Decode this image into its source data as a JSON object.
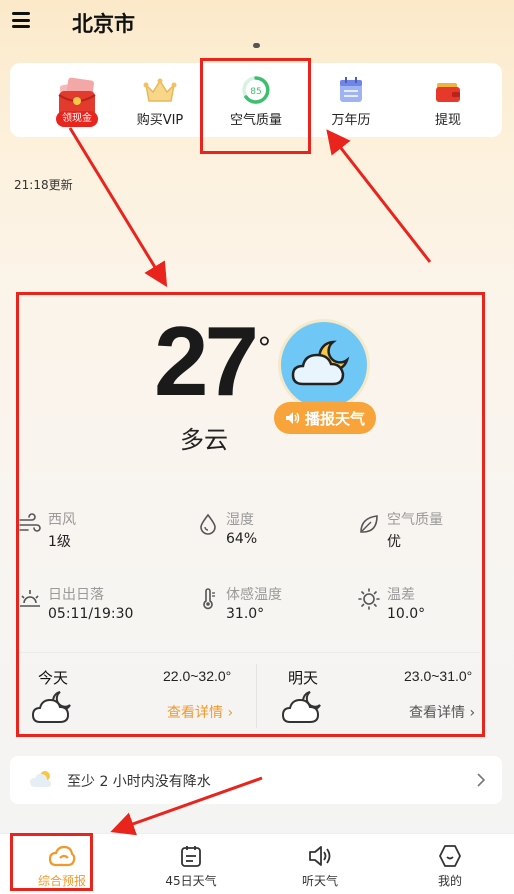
{
  "header": {
    "city": "北京市"
  },
  "shortcuts": [
    {
      "label": "",
      "badge": "领现金",
      "icon": "red-envelope-icon"
    },
    {
      "label": "购买VIP",
      "icon": "vip-crown-icon"
    },
    {
      "label": "空气质量",
      "icon": "air-quality-gauge-icon",
      "gauge_value": "85"
    },
    {
      "label": "万年历",
      "icon": "calendar-icon"
    },
    {
      "label": "提现",
      "icon": "wallet-icon"
    }
  ],
  "update_time": "21:18更新",
  "current": {
    "temperature": "27",
    "degree_symbol": "°",
    "condition": "多云",
    "broadcast_label": "播报天气",
    "icon": "partly-cloudy-night-icon"
  },
  "stats": [
    {
      "label": "西风",
      "value": "1级",
      "icon": "wind-icon"
    },
    {
      "label": "湿度",
      "value": "64%",
      "icon": "humidity-drop-icon"
    },
    {
      "label": "空气质量",
      "value": "优",
      "icon": "leaf-icon"
    },
    {
      "label": "日出日落",
      "value": "05:11/19:30",
      "icon": "sunrise-icon"
    },
    {
      "label": "体感温度",
      "value": "31.0°",
      "icon": "thermometer-icon"
    },
    {
      "label": "温差",
      "value": "10.0°",
      "icon": "sun-icon"
    }
  ],
  "forecast": {
    "today": {
      "title": "今天",
      "range": "22.0~32.0°",
      "link": "查看详情 ›",
      "link_color": "#f19a2c"
    },
    "tomorrow": {
      "title": "明天",
      "range": "23.0~31.0°",
      "link": "查看详情 ›",
      "link_color": "#555555"
    }
  },
  "rain_notice": {
    "text": "至少 2 小时内没有降水",
    "icon": "cloud-sun-icon"
  },
  "bottom_nav": [
    {
      "label": "综合预报",
      "icon": "cloud-outline-icon",
      "active": true
    },
    {
      "label": "45日天气",
      "icon": "calendar-list-icon"
    },
    {
      "label": "听天气",
      "icon": "speaker-icon"
    },
    {
      "label": "我的",
      "icon": "profile-hex-icon"
    }
  ],
  "colors": {
    "accent": "#f8a43a",
    "annotation": "#e8241d",
    "active_nav": "#f19a2c"
  }
}
